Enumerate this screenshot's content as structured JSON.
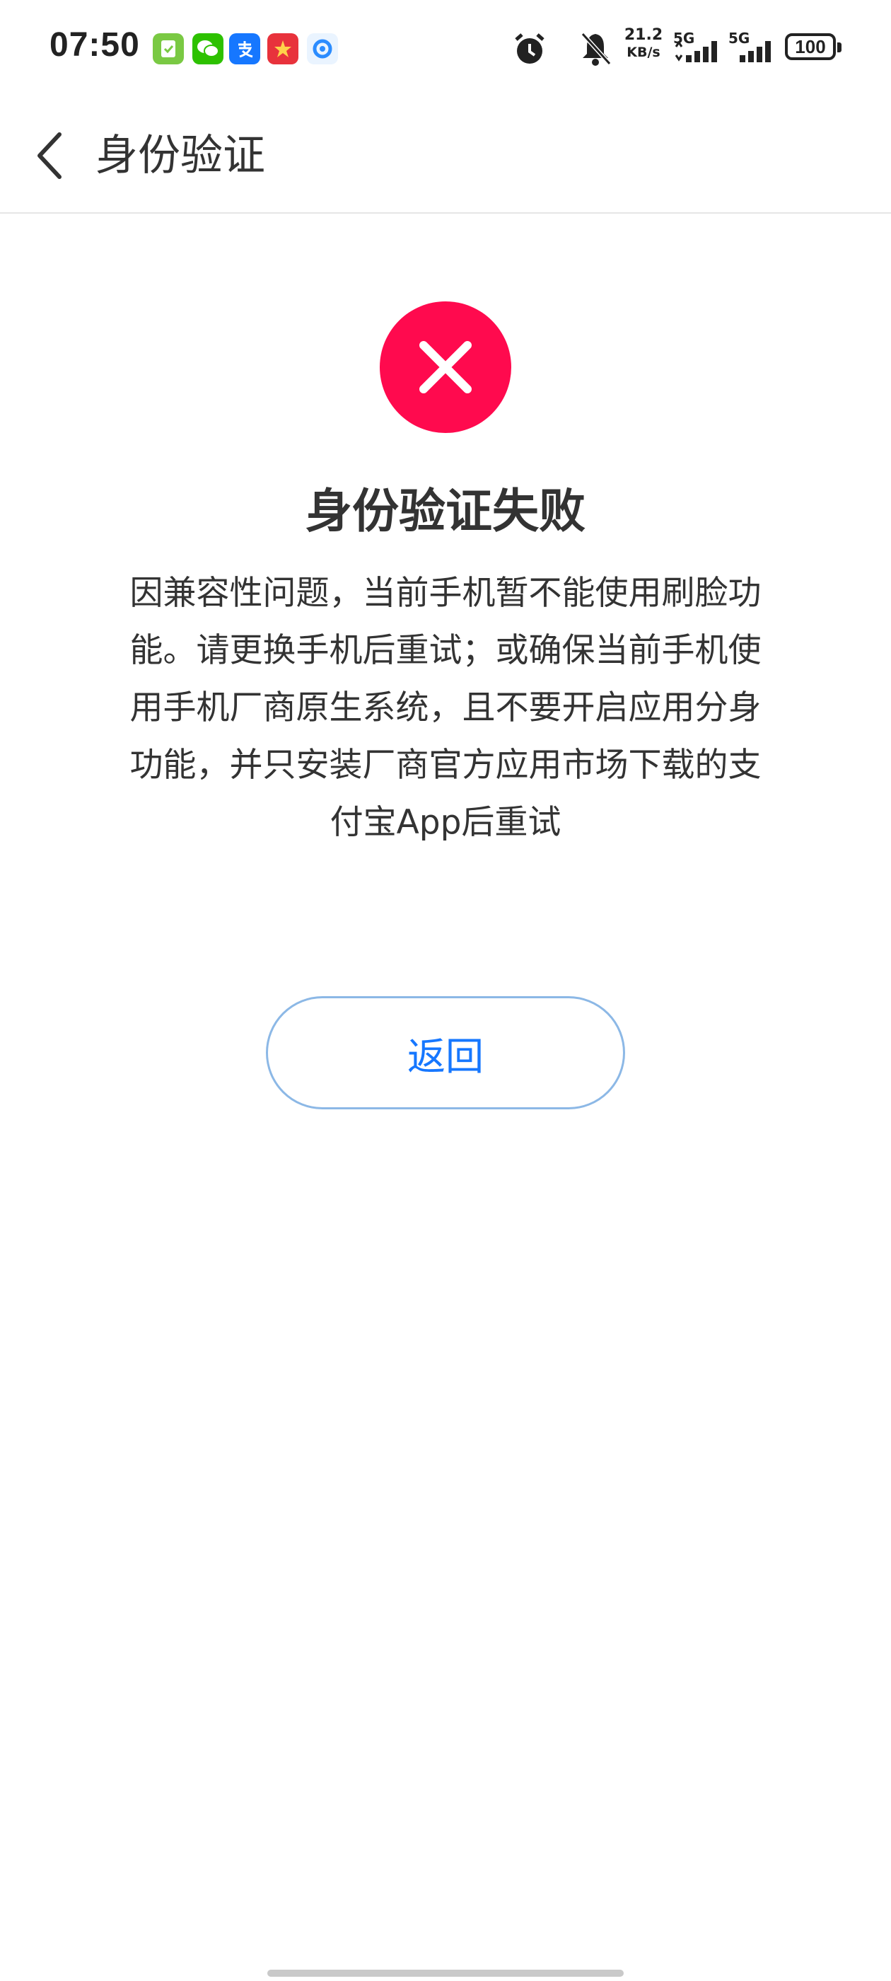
{
  "status_bar": {
    "time": "07:50",
    "notification_icons": [
      {
        "name": "task-app-icon",
        "glyph": "✓",
        "color": "#7ac943"
      },
      {
        "name": "wechat-icon",
        "glyph": "●",
        "color": "#2dc100"
      },
      {
        "name": "alipay-icon",
        "glyph": "支",
        "color": "#1677ff"
      },
      {
        "name": "game-app-icon",
        "glyph": "✦",
        "color": "#e8323c"
      },
      {
        "name": "browser-icon",
        "glyph": "◐",
        "color": "#4aa3ff"
      }
    ],
    "net_speed_value": "21.2",
    "net_speed_unit": "KB/s",
    "signal_label_1": "5G",
    "signal_label_2": "5G",
    "battery": "100"
  },
  "nav": {
    "title": "身份验证"
  },
  "result": {
    "title": "身份验证失败",
    "description_lines": [
      "因兼容性问题，当前手机暂不能使用刷脸功",
      "能。请更换手机后重试；或确保当前手机使",
      "用手机厂商原生系统，且不要开启应用分身",
      "功能，并只安装厂商官方应用市场下载的支",
      "付宝App后重试"
    ],
    "error_color": "#ff0a4e"
  },
  "actions": {
    "return_label": "返回"
  }
}
